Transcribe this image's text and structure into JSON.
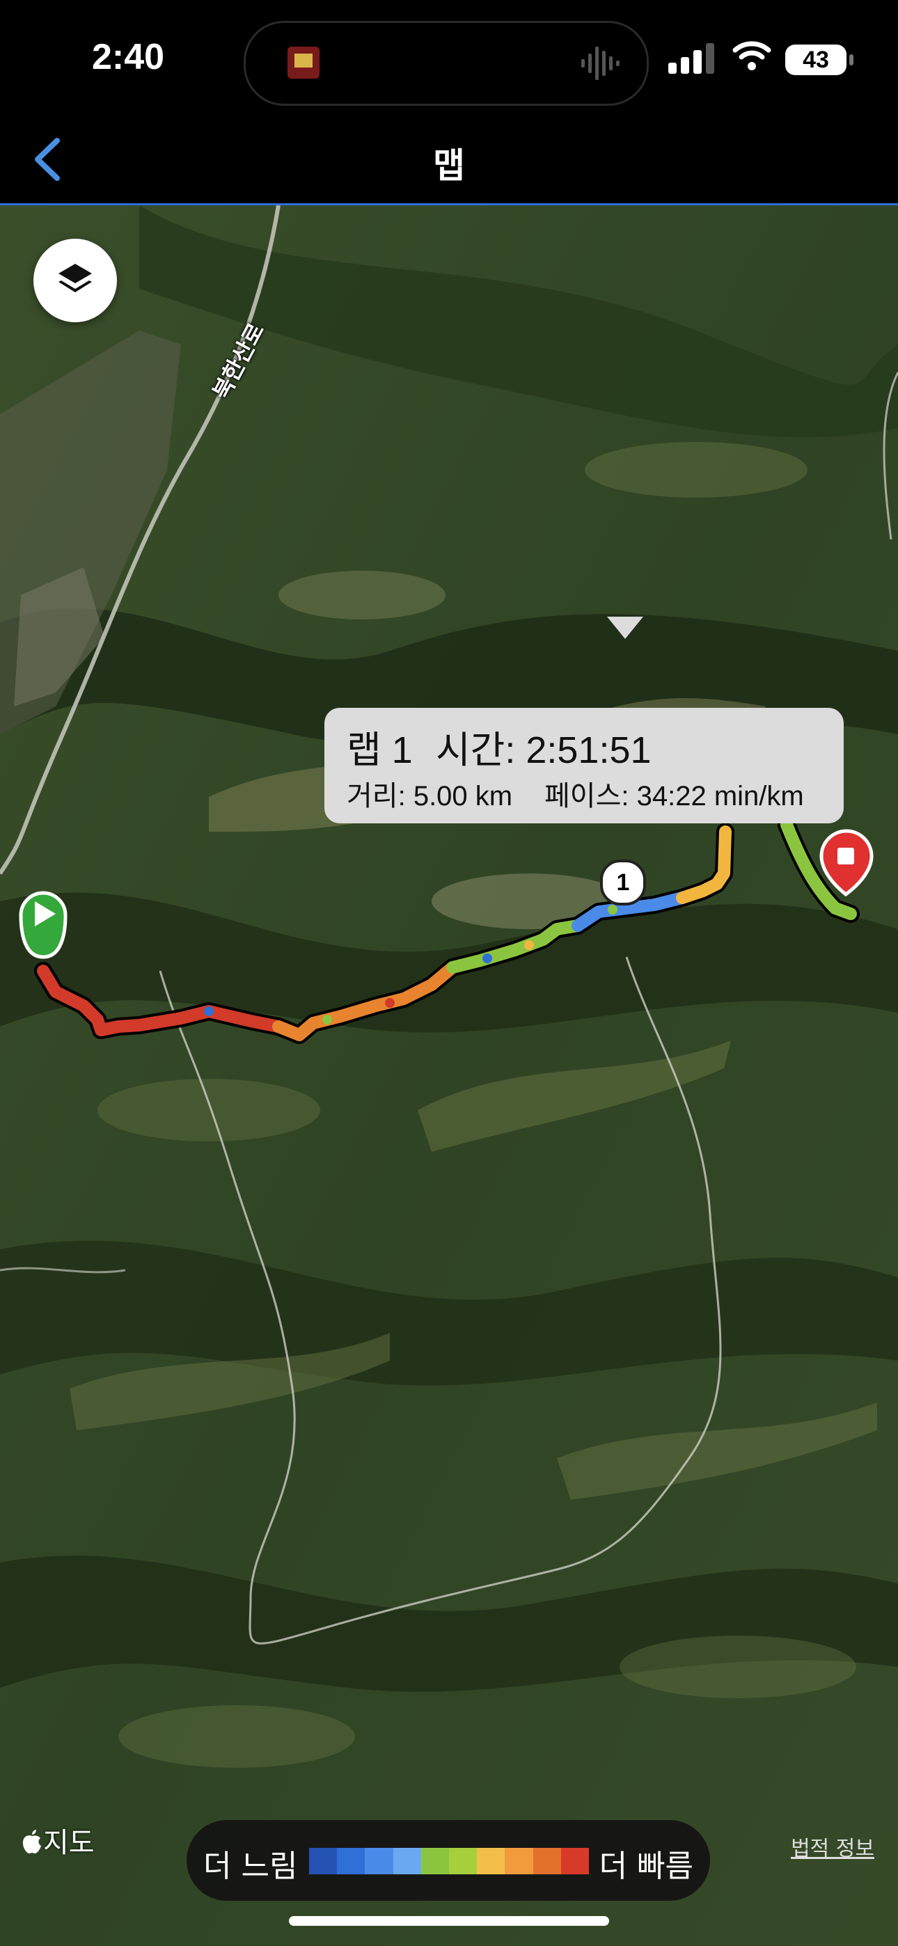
{
  "status_bar": {
    "time": "2:40",
    "battery": "43"
  },
  "nav": {
    "title": "맵",
    "back_icon": "chevron-left-icon"
  },
  "map": {
    "road_label": "북한산로",
    "callout": {
      "lap": "랩 1",
      "time": "시간: 2:51:51",
      "distance": "거리: 5.00 km",
      "pace": "페이스: 34:22 min/km"
    },
    "lap_marker": "1",
    "apple_maps_label": "지도",
    "legal_link": "법적 정보"
  },
  "legend": {
    "slow_label": "더 느림",
    "fast_label": "더 빠름",
    "colors": [
      "#2452b5",
      "#2f6fd6",
      "#4a8ae8",
      "#6aa9f2",
      "#8bc53f",
      "#a6cf3c",
      "#f2c04a",
      "#f29b3d",
      "#e3702d",
      "#d83a2a"
    ]
  },
  "colors": {
    "accent": "#2e6fd8",
    "start": "#34a83a",
    "end": "#e03030"
  }
}
